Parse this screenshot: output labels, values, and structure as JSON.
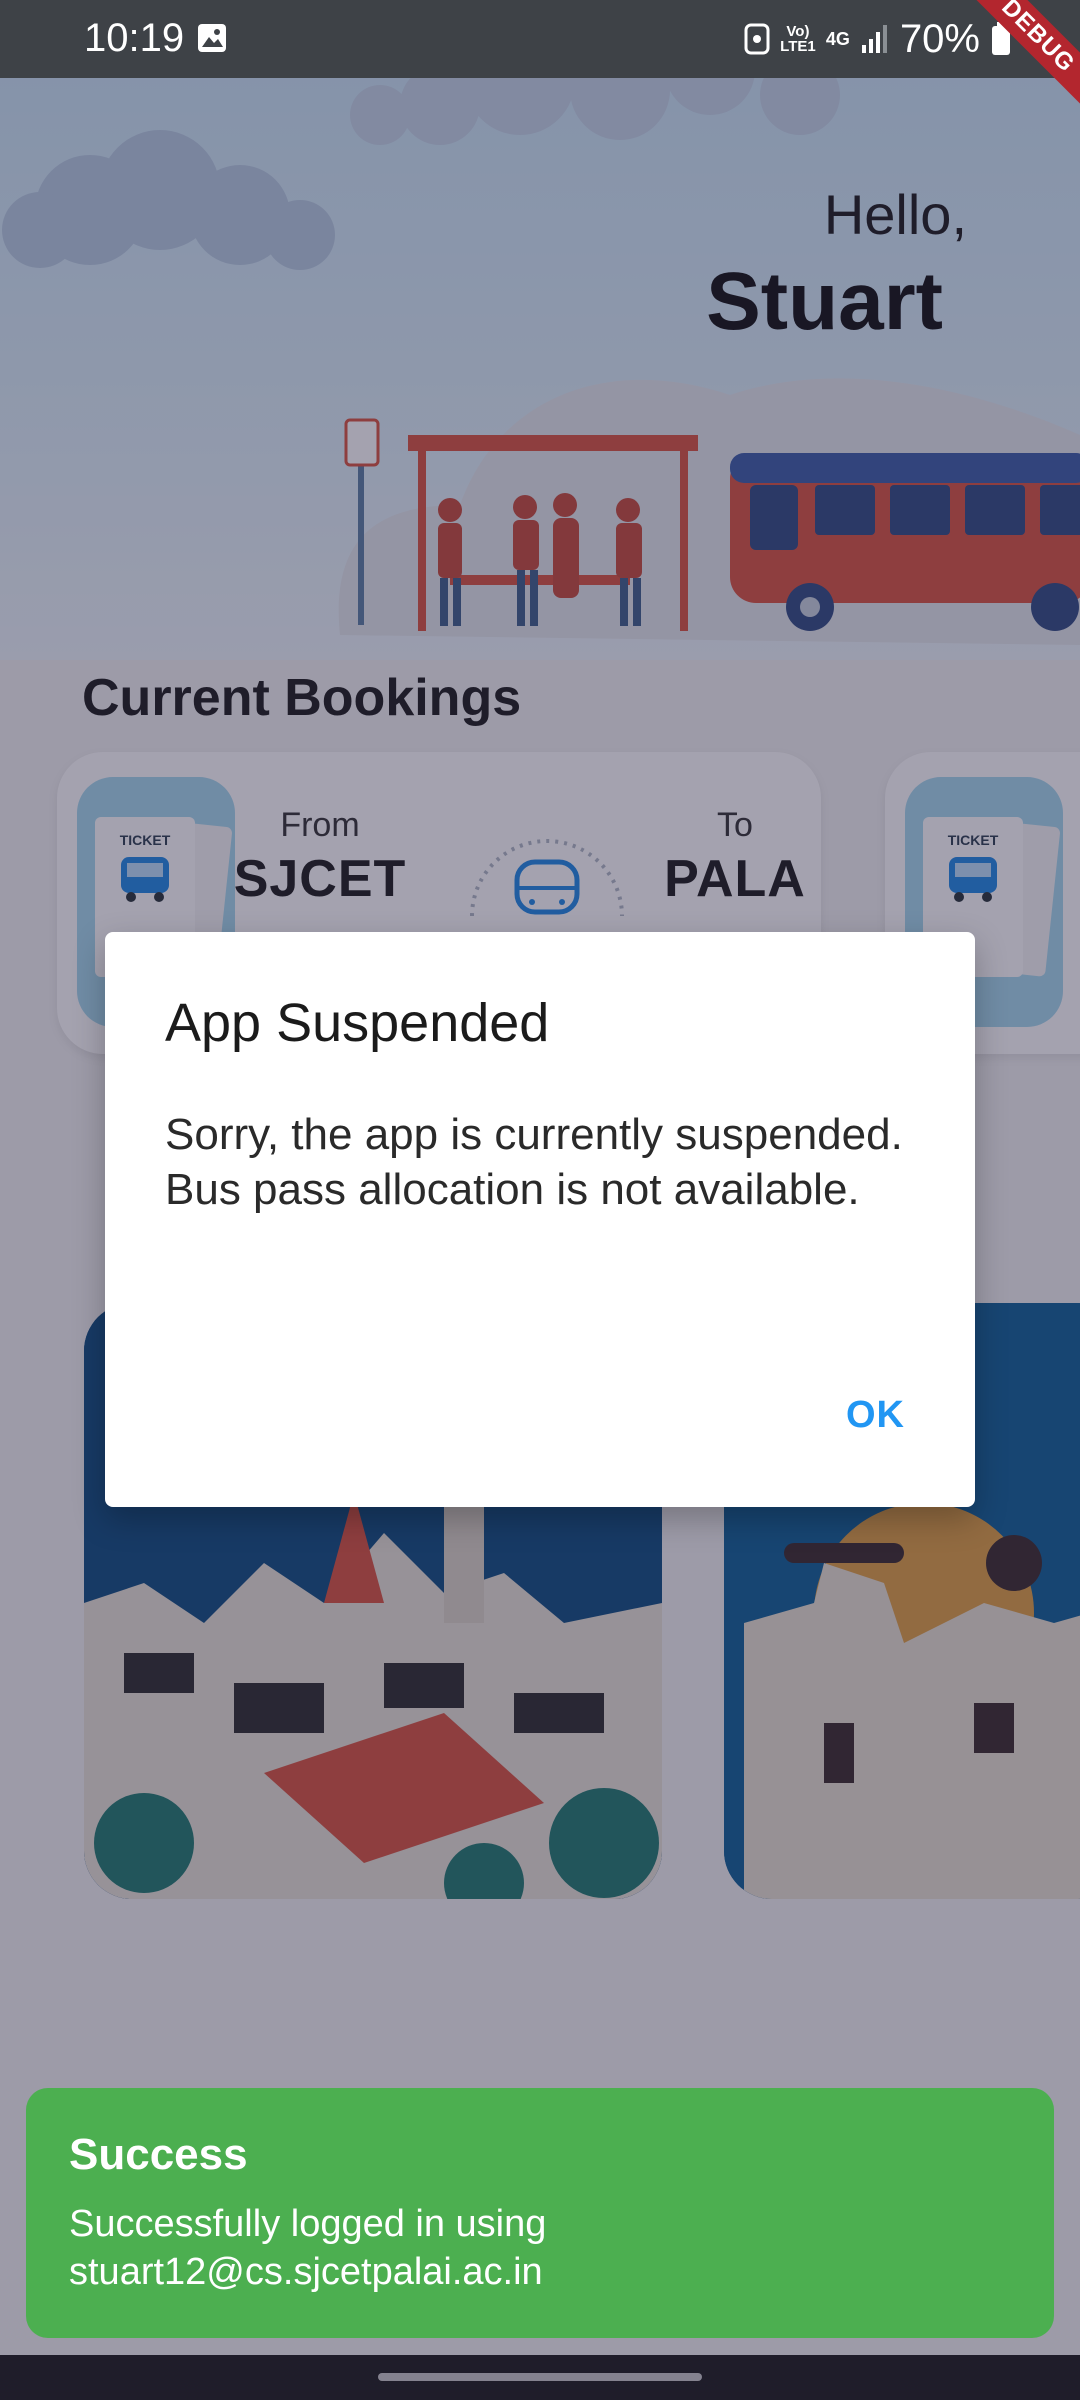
{
  "status_bar": {
    "time": "10:19",
    "battery": "70%",
    "volte_label": "Vo) LTE1",
    "network_label": "4G",
    "debug_banner": "DEBUG"
  },
  "header": {
    "greeting": "Hello,",
    "user_name": "Stuart"
  },
  "bookings": {
    "section_title": "Current Bookings",
    "ticket_label": "TICKET",
    "items": [
      {
        "from_label": "From",
        "from": "SJCET",
        "to_label": "To",
        "to": "PALA"
      }
    ]
  },
  "dialog": {
    "title": "App Suspended",
    "message": "Sorry, the app is currently suspended. Bus pass allocation is not available.",
    "ok_label": "OK"
  },
  "snackbar": {
    "title": "Success",
    "message": "Successfully logged in using stuart12@cs.sjcetpalai.ac.in"
  },
  "colors": {
    "accent": "#2196f3",
    "success": "#4caf50",
    "bus_red": "#d9543f",
    "scrim": "#262240"
  }
}
